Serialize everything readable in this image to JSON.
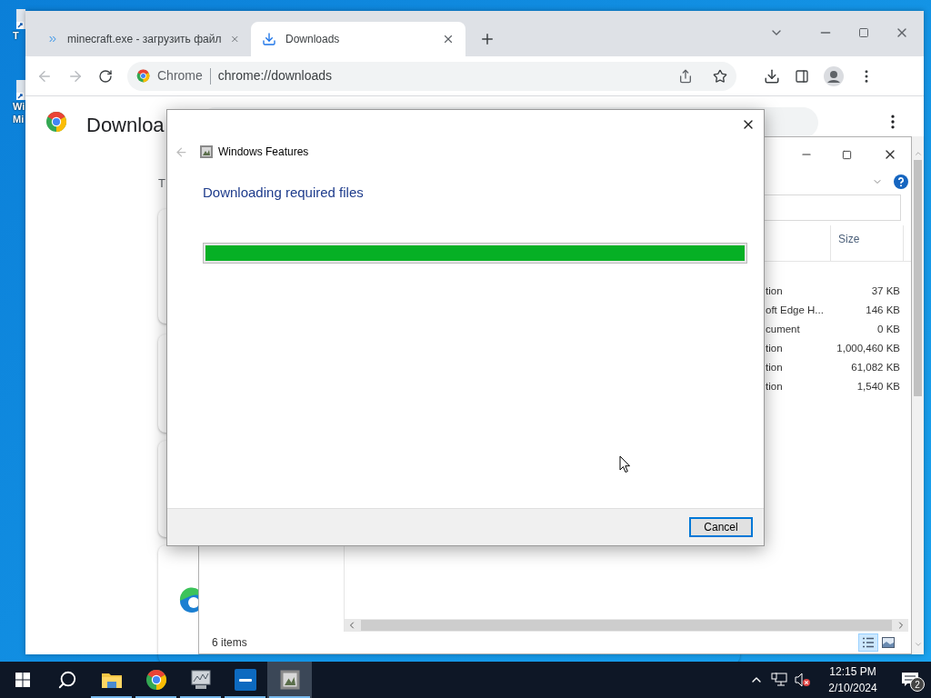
{
  "desktop": {
    "icons": [
      {
        "lines": [
          "T"
        ]
      },
      {
        "lines": [
          "Wi",
          "Mi"
        ]
      }
    ]
  },
  "browser": {
    "tabs": [
      {
        "title": "minecraft.exe - загрузить файл",
        "kind": "site",
        "selected": false
      },
      {
        "title": "Downloads",
        "kind": "downloads",
        "selected": true
      }
    ],
    "nav": {
      "back_disabled": true,
      "forward_disabled": true
    },
    "omnibox": {
      "chip": "Chrome",
      "url": "chrome://downloads"
    },
    "page": {
      "title": "Downloa",
      "section": "T"
    }
  },
  "explorer": {
    "columns": [
      {
        "label": "Size"
      }
    ],
    "rows": [
      {
        "type": "tion",
        "size": "37 KB"
      },
      {
        "type": "oft Edge H...",
        "size": "146 KB"
      },
      {
        "type": "cument",
        "size": "0 KB"
      },
      {
        "type": "tion",
        "size": "1,000,460 KB"
      },
      {
        "type": "tion",
        "size": "61,082 KB"
      },
      {
        "type": "tion",
        "size": "1,540 KB"
      }
    ],
    "status": "6 items",
    "views": [
      {
        "kind": "details",
        "selected": true
      },
      {
        "kind": "preview",
        "selected": false
      }
    ]
  },
  "dialog": {
    "title": "Windows Features",
    "back_disabled": true,
    "heading": "Downloading required files",
    "progress": {
      "level": 1
    },
    "buttons": [
      {
        "label": "Cancel",
        "default": true
      }
    ]
  },
  "taskbar": {
    "items": [
      {
        "kind": "start",
        "running": false,
        "selected": false
      },
      {
        "kind": "search",
        "running": false,
        "selected": false
      },
      {
        "kind": "explorer",
        "running": true,
        "selected": false
      },
      {
        "kind": "chrome",
        "running": true,
        "selected": false
      },
      {
        "kind": "monitor",
        "running": true,
        "selected": false
      },
      {
        "kind": "intel",
        "running": true,
        "selected": false
      },
      {
        "kind": "features",
        "running": true,
        "selected": true
      }
    ],
    "sound_muted": true,
    "time": "12:15 PM",
    "date": "2/10/2024",
    "notifications": "2"
  }
}
